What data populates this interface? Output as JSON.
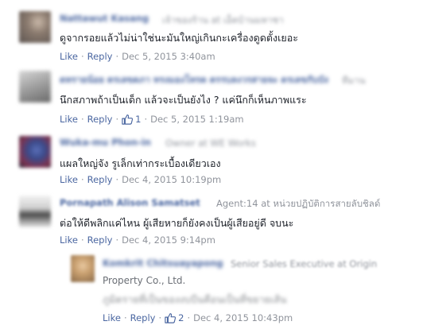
{
  "comments": [
    {
      "name": "Nattawut Kasang",
      "meta": "เจ้าของร้าน at เอ็ดบ้านมหาชา",
      "text": "ดูจากรอยแล้วไม่น่าใช่นะมันใหญ่เกินกะเครื่องดูดตั้งเยอะ",
      "like": "Like",
      "reply": "Reply",
      "date": "Dec 5, 2015 3:40am"
    },
    {
      "name": "ดทรายน้อย ตรเลขดภา ทรงมองโทรด ตรรบลงวรสายจะ ดรเลขกับบัง",
      "meta": "ทีมาน",
      "text": "นึกสภาพถ้าเป็นเด็ก แล้วจะเป็นยังไง ? แค่นึกก็เห็นภาพแระ",
      "like": "Like",
      "reply": "Reply",
      "likes": "1",
      "date": "Dec 5, 2015 1:19am"
    },
    {
      "name": "Wuka-mu Phon-in",
      "meta": "Owner at WE Works",
      "text": "แผลใหญ่จัง รูเล็กเท่ากระเบื้องเดียวเอง",
      "like": "Like",
      "reply": "Reply",
      "date": "Dec 4, 2015 10:19pm"
    },
    {
      "name": "Pornapath Alison Samatset",
      "meta": "Agent:14 at หน่วยปฏิบัติการสายลับชิลด์",
      "text": "ต่อให้ดีพลิกแค่ไหน ผู้เสียหายก็ยังคงเป็นผู้เสียอยู่ดี จบนะ",
      "like": "Like",
      "reply": "Reply",
      "date": "Dec 4, 2015 9:14pm"
    },
    {
      "name": "Komkrit Chitsuayapong",
      "meta": "Senior Sales Executive at Origin",
      "meta2": "Property Co., Ltd.",
      "text": "ภูมิตรายที่เป็นของงบบีนคือนเป็นที่ขยายเส้น",
      "like": "Like",
      "reply": "Reply",
      "likes": "2",
      "date": "Dec 4, 2015 10:43pm"
    }
  ],
  "colors": {
    "link": "#4b67a1",
    "meta": "#90949c",
    "text": "#1d2129"
  },
  "icons": {
    "like": "thumbs-up-icon"
  }
}
